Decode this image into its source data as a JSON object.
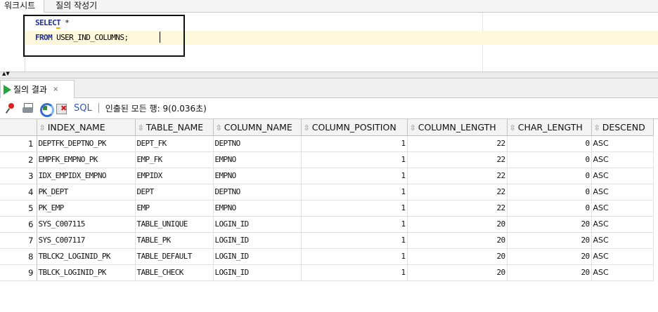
{
  "top_tabs": [
    "워크시트",
    "질의 작성기"
  ],
  "editor": {
    "line1_keyword": "SELECT",
    "line1_rest": " *",
    "line2_keyword": "FROM",
    "line2_rest": " USER_IND_COLUMNS;"
  },
  "results_tab": {
    "label": "질의 결과",
    "close": "×"
  },
  "toolbar": {
    "sql_label": "SQL",
    "status": "인출된 모든 행: 9(0.036초)"
  },
  "grid": {
    "columns": [
      "INDEX_NAME",
      "TABLE_NAME",
      "COLUMN_NAME",
      "COLUMN_POSITION",
      "COLUMN_LENGTH",
      "CHAR_LENGTH",
      "DESCEND"
    ],
    "rows": [
      [
        "1",
        "DEPTFK_DEPTNO_PK",
        "DEPT_FK",
        "DEPTNO",
        "1",
        "22",
        "0",
        "ASC"
      ],
      [
        "2",
        "EMPFK_EMPNO_PK",
        "EMP_FK",
        "EMPNO",
        "1",
        "22",
        "0",
        "ASC"
      ],
      [
        "3",
        "IDX_EMPIDX_EMPNO",
        "EMPIDX",
        "EMPNO",
        "1",
        "22",
        "0",
        "ASC"
      ],
      [
        "4",
        "PK_DEPT",
        "DEPT",
        "DEPTNO",
        "1",
        "22",
        "0",
        "ASC"
      ],
      [
        "5",
        "PK_EMP",
        "EMP",
        "EMPNO",
        "1",
        "22",
        "0",
        "ASC"
      ],
      [
        "6",
        "SYS_C007115",
        "TABLE_UNIQUE",
        "LOGIN_ID",
        "1",
        "20",
        "20",
        "ASC"
      ],
      [
        "7",
        "SYS_C007117",
        "TABLE_PK",
        "LOGIN_ID",
        "1",
        "20",
        "20",
        "ASC"
      ],
      [
        "8",
        "TBLCK2_LOGINID_PK",
        "TABLE_DEFAULT",
        "LOGIN_ID",
        "1",
        "20",
        "20",
        "ASC"
      ],
      [
        "9",
        "TBLCK_LOGINID_PK",
        "TABLE_CHECK",
        "LOGIN_ID",
        "1",
        "20",
        "20",
        "ASC"
      ]
    ]
  },
  "colors": {
    "keyword": "#1b2f9e",
    "run_icon": "#23a63a",
    "sql_link": "#2f56b8",
    "current_line": "#fdf8dc"
  },
  "icons": [
    "pin-icon",
    "print-icon",
    "refresh-icon",
    "cancel-icon",
    "run-icon",
    "sort-icon"
  ]
}
